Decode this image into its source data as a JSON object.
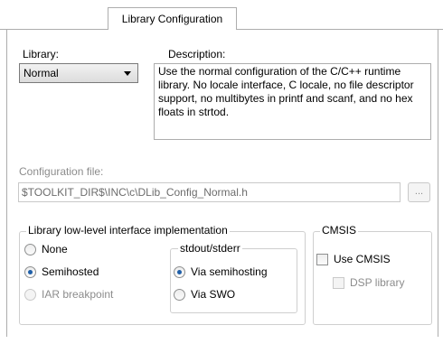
{
  "tab": {
    "label": "Library Configuration"
  },
  "library": {
    "label": "Library:",
    "selected": "Normal"
  },
  "description": {
    "label": "Description:",
    "text": "Use the normal configuration of the C/C++ runtime library. No locale interface, C locale, no file descriptor support, no multibytes in printf and scanf, and no hex floats in strtod."
  },
  "config_file": {
    "label": "Configuration file:",
    "value": "$TOOLKIT_DIR$\\INC\\c\\DLib_Config_Normal.h",
    "browse_label": "..."
  },
  "low_level": {
    "legend": "Library low-level interface implementation",
    "options": [
      {
        "label": "None",
        "checked": false,
        "enabled": true
      },
      {
        "label": "Semihosted",
        "checked": true,
        "enabled": true
      },
      {
        "label": "IAR breakpoint",
        "checked": false,
        "enabled": false
      }
    ]
  },
  "stdout": {
    "legend": "stdout/stderr",
    "options": [
      {
        "label": "Via semihosting",
        "checked": true,
        "enabled": true
      },
      {
        "label": "Via SWO",
        "checked": false,
        "enabled": true
      }
    ]
  },
  "cmsis": {
    "legend": "CMSIS",
    "use_cmsis": {
      "label": "Use CMSIS",
      "checked": false,
      "enabled": true
    },
    "dsp_library": {
      "label": "DSP library",
      "checked": false,
      "enabled": false
    }
  },
  "colors": {
    "border": "#adadad",
    "disabled_text": "#8c8c8c",
    "radio_dot": "#1f5fa8"
  }
}
